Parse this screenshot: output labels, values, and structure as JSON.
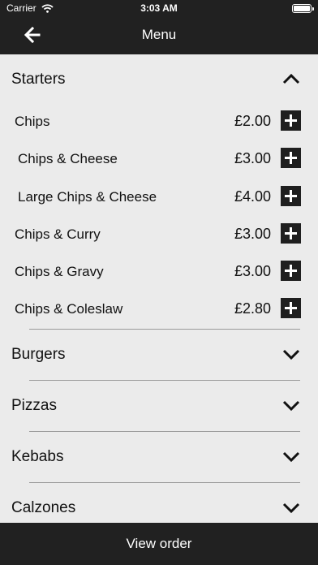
{
  "status_bar": {
    "carrier": "Carrier",
    "time": "3:03 AM"
  },
  "nav": {
    "title": "Menu",
    "back_icon": "arrow-left-icon"
  },
  "categories": [
    {
      "label": "Starters",
      "expanded": true
    },
    {
      "label": "Burgers",
      "expanded": false
    },
    {
      "label": "Pizzas",
      "expanded": false
    },
    {
      "label": "Kebabs",
      "expanded": false
    },
    {
      "label": "Calzones",
      "expanded": false
    }
  ],
  "starters_items": [
    {
      "name": "Chips",
      "price": "£2.00"
    },
    {
      "name": "Chips & Cheese",
      "price": "£3.00"
    },
    {
      "name": "Large Chips & Cheese",
      "price": "£4.00"
    },
    {
      "name": "Chips & Curry",
      "price": "£3.00"
    },
    {
      "name": "Chips & Gravy",
      "price": "£3.00"
    },
    {
      "name": "Chips & Coleslaw",
      "price": "£2.80"
    }
  ],
  "footer": {
    "view_order_label": "View order"
  },
  "colors": {
    "bar": "#212121",
    "background": "#ebebeb",
    "button": "#1f1f1f"
  }
}
